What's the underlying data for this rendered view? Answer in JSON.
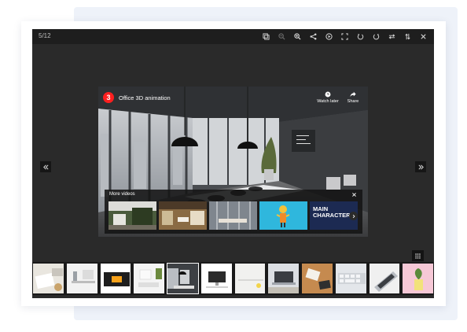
{
  "viewer": {
    "counter": "5/12",
    "toolbar": [
      {
        "name": "thumbnails-icon",
        "enabled": true
      },
      {
        "name": "zoom-out-icon",
        "enabled": false
      },
      {
        "name": "zoom-in-icon",
        "enabled": true
      },
      {
        "name": "share-icon",
        "enabled": true
      },
      {
        "name": "play-slideshow-icon",
        "enabled": true
      },
      {
        "name": "fullscreen-icon",
        "enabled": true
      },
      {
        "name": "rotate-left-icon",
        "enabled": true
      },
      {
        "name": "rotate-right-icon",
        "enabled": true
      },
      {
        "name": "flip-horizontal-icon",
        "enabled": true
      },
      {
        "name": "flip-vertical-icon",
        "enabled": true
      },
      {
        "name": "close-icon",
        "enabled": true
      }
    ]
  },
  "video": {
    "logo_text": "3",
    "title": "Office 3D animation",
    "watch_later": "Watch later",
    "share": "Share",
    "more_videos": "More videos",
    "more_items": [
      {
        "kind": "office-green"
      },
      {
        "kind": "cool-office",
        "text": ""
      },
      {
        "kind": "office-glass"
      },
      {
        "kind": "cartoon"
      },
      {
        "kind": "main-character",
        "text": "MAIN CHARACTER"
      }
    ]
  },
  "thumbnails": {
    "active_index": 4,
    "count": 12
  },
  "colors": {
    "viewer_bg": "#2a2a2a",
    "toolbar_bg": "#1e1e1e",
    "youtube_red": "#ff1f1f",
    "page_panel": "#eef2f9"
  }
}
